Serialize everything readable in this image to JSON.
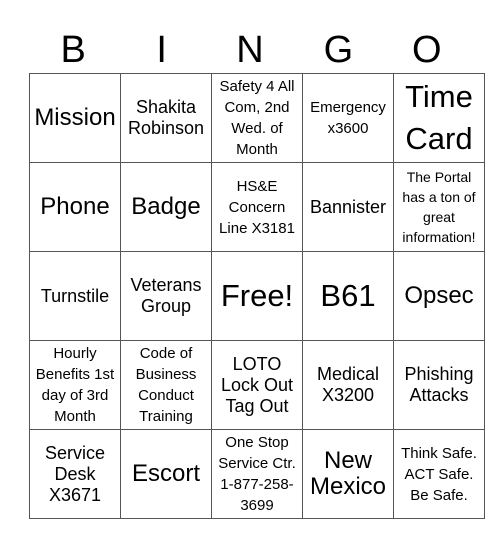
{
  "header": [
    "B",
    "I",
    "N",
    "G",
    "O"
  ],
  "cells": [
    [
      {
        "text": "Mission",
        "size": "l"
      },
      {
        "text": "Shakita Robinson",
        "size": "m"
      },
      {
        "text": "Safety 4 All Com, 2nd Wed. of Month",
        "size": "s"
      },
      {
        "text": "Emergency x3600",
        "size": "s"
      },
      {
        "text": "Time Card",
        "size": "xl"
      }
    ],
    [
      {
        "text": "Phone",
        "size": "l"
      },
      {
        "text": "Badge",
        "size": "l"
      },
      {
        "text": "HS&E Concern Line X3181",
        "size": "s"
      },
      {
        "text": "Bannister",
        "size": "m"
      },
      {
        "text": "The Portal has a ton of great information!",
        "size": "xs"
      }
    ],
    [
      {
        "text": "Turnstile",
        "size": "m"
      },
      {
        "text": "Veterans Group",
        "size": "m"
      },
      {
        "text": "Free!",
        "size": "xl"
      },
      {
        "text": "B61",
        "size": "xl"
      },
      {
        "text": "Opsec",
        "size": "l"
      }
    ],
    [
      {
        "text": "Hourly Benefits 1st day of 3rd Month",
        "size": "s"
      },
      {
        "text": "Code of Business Conduct Training",
        "size": "s"
      },
      {
        "text": "LOTO Lock Out Tag Out",
        "size": "m"
      },
      {
        "text": "Medical X3200",
        "size": "m"
      },
      {
        "text": "Phishing Attacks",
        "size": "m"
      }
    ],
    [
      {
        "text": "Service Desk X3671",
        "size": "m"
      },
      {
        "text": "Escort",
        "size": "l"
      },
      {
        "text": "One Stop Service Ctr. 1-877-258-3699",
        "size": "s"
      },
      {
        "text": "New Mexico",
        "size": "l"
      },
      {
        "text": "Think Safe. ACT Safe. Be Safe.",
        "size": "s"
      }
    ]
  ]
}
